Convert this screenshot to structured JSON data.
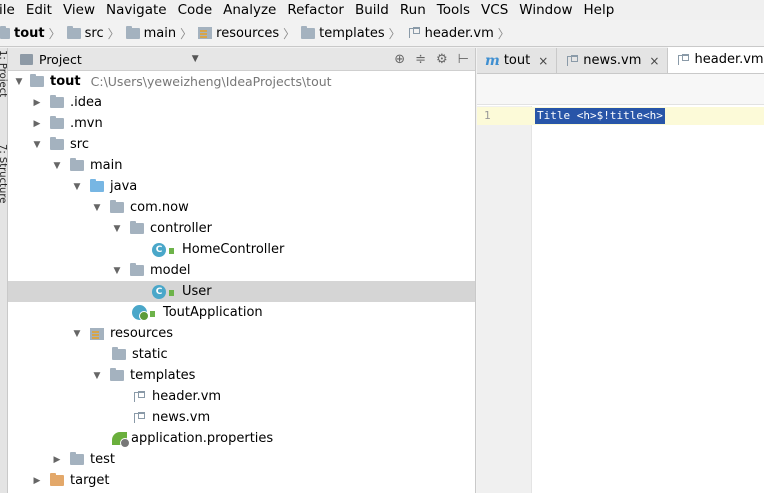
{
  "menu": [
    "ile",
    "Edit",
    "View",
    "Navigate",
    "Code",
    "Analyze",
    "Refactor",
    "Build",
    "Run",
    "Tools",
    "VCS",
    "Window",
    "Help"
  ],
  "breadcrumbs": [
    "tout",
    "src",
    "main",
    "resources",
    "templates",
    "header.vm"
  ],
  "left_strip": {
    "tab1": "1: Project",
    "tab2": "7: Structure"
  },
  "project_panel": {
    "title": "Project",
    "tools": [
      "⊕",
      "≑",
      "⚙",
      "⊢"
    ]
  },
  "tree": [
    {
      "name": "tout",
      "path": "C:\\Users\\yeweizheng\\IdeaProjects\\tout",
      "arrow": "▼"
    },
    {
      "name": ".idea",
      "arrow": "▶"
    },
    {
      "name": ".mvn",
      "arrow": "▶"
    },
    {
      "name": "src",
      "arrow": "▼"
    },
    {
      "name": "main",
      "arrow": "▼"
    },
    {
      "name": "java",
      "arrow": "▼"
    },
    {
      "name": "com.now",
      "arrow": "▼"
    },
    {
      "name": "controller",
      "arrow": "▼"
    },
    {
      "name": "HomeController",
      "badge": "C"
    },
    {
      "name": "model",
      "arrow": "▼"
    },
    {
      "name": "User",
      "badge": "C"
    },
    {
      "name": "ToutApplication"
    },
    {
      "name": "resources",
      "arrow": "▼"
    },
    {
      "name": "static"
    },
    {
      "name": "templates",
      "arrow": "▼"
    },
    {
      "name": "header.vm"
    },
    {
      "name": "news.vm"
    },
    {
      "name": "application.properties"
    },
    {
      "name": "test",
      "arrow": "▶"
    },
    {
      "name": "target",
      "arrow": "▶"
    }
  ],
  "editor": {
    "tabs": [
      {
        "label": "tout",
        "icon": "m",
        "close": "×"
      },
      {
        "label": "news.vm",
        "close": "×"
      },
      {
        "label": "header.vm",
        "close": "×"
      }
    ],
    "line_number": "1",
    "code": "Title <h>$!title<h>"
  },
  "colors": {
    "selection": "#2855a8",
    "current_line": "#fcfad8",
    "selected_row": "#d5d5d5"
  }
}
